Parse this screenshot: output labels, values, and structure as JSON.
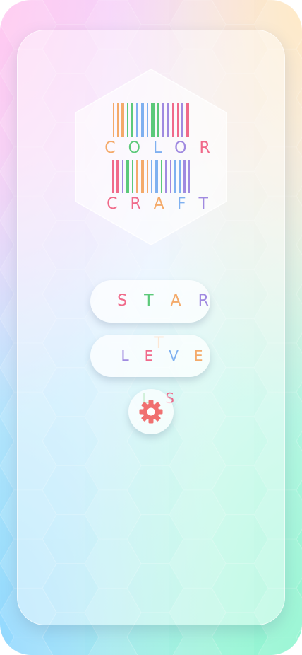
{
  "app": {
    "title_line1": "COLOR",
    "title_line2": "CRAFT"
  },
  "menu": {
    "start_label": "START",
    "levels_label": "LEVELS",
    "settings_icon": "gear-icon"
  },
  "colors": {
    "pink": "#f06a8a",
    "orange": "#f4aa6a",
    "green": "#5cc97a",
    "blue": "#7fb0f0",
    "purple": "#a08ae0",
    "gear": "#f07070",
    "letter_sequence": [
      "#f4aa6a",
      "#5cc97a",
      "#7fb0f0",
      "#a08ae0",
      "#f06a8a",
      "#f4aa6a"
    ]
  }
}
